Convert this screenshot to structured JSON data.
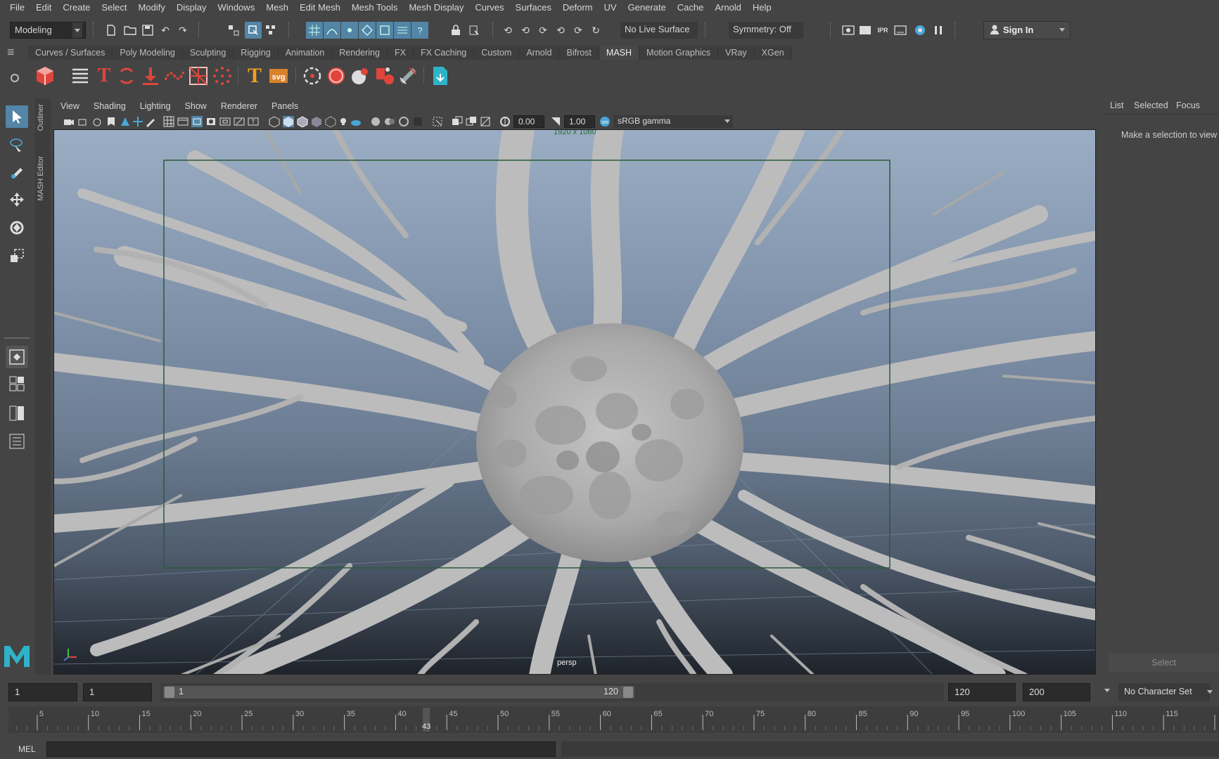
{
  "menu": [
    "File",
    "Edit",
    "Create",
    "Select",
    "Modify",
    "Display",
    "Windows",
    "Mesh",
    "Edit Mesh",
    "Mesh Tools",
    "Mesh Display",
    "Curves",
    "Surfaces",
    "Deform",
    "UV",
    "Generate",
    "Cache",
    "Arnold",
    "Help"
  ],
  "status_line": {
    "mode": "Modeling",
    "live_surface": "No Live Surface",
    "symmetry": "Symmetry: Off",
    "sign_in": "Sign In"
  },
  "shelf_tabs": [
    "Curves / Surfaces",
    "Poly Modeling",
    "Sculpting",
    "Rigging",
    "Animation",
    "Rendering",
    "FX",
    "FX Caching",
    "Custom",
    "Arnold",
    "Bifrost",
    "MASH",
    "Motion Graphics",
    "VRay",
    "XGen"
  ],
  "active_shelf_tab": "MASH",
  "side_tabs": [
    "Outliner",
    "MASH Editor"
  ],
  "panel_menu": [
    "View",
    "Shading",
    "Lighting",
    "Show",
    "Renderer",
    "Panels"
  ],
  "panel_toolbar": {
    "exposure": "0.00",
    "gamma": "1.00",
    "color_space": "sRGB gamma"
  },
  "viewport": {
    "resolution_label": "1920 x 1080",
    "camera": "persp"
  },
  "attribute_panel": {
    "tabs": [
      "List",
      "Selected",
      "Focus"
    ],
    "message": "Make a selection to view",
    "select_button": "Select"
  },
  "time_range": {
    "start": "1",
    "playback_start": "1",
    "slider_start": "1",
    "slider_end": "120",
    "playback_end": "120",
    "end": "200",
    "character_set": "No Character Set"
  },
  "timeline": {
    "ticks": [
      "5",
      "10",
      "15",
      "20",
      "25",
      "30",
      "35",
      "40",
      "45",
      "50",
      "55",
      "60",
      "65",
      "70",
      "75",
      "80",
      "85",
      "90",
      "95",
      "100",
      "105",
      "110",
      "115"
    ],
    "current_frame": "43"
  },
  "command_line": {
    "language": "MEL"
  },
  "colors": {
    "ui_bg": "#444444",
    "field_bg": "#2b2b2b",
    "accent_blue": "#5285a6",
    "highlight": "#4aa6d6",
    "maya_logo": "#2fb3c8"
  }
}
